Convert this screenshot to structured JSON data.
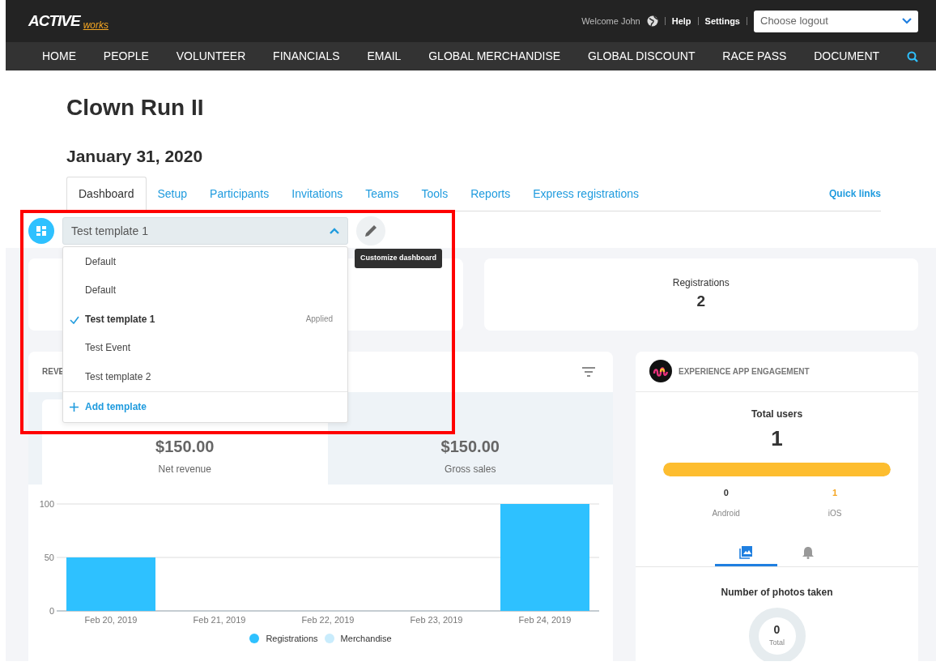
{
  "header": {
    "logo_main": "ACTIVE",
    "logo_sub": "works",
    "welcome": "Welcome John",
    "links": [
      "Help",
      "Settings"
    ],
    "logout_select": {
      "placeholder": "Choose logout"
    }
  },
  "nav": [
    "HOME",
    "PEOPLE",
    "VOLUNTEER",
    "FINANCIALS",
    "EMAIL",
    "GLOBAL MERCHANDISE",
    "GLOBAL DISCOUNT",
    "RACE PASS",
    "DOCUMENT"
  ],
  "event": {
    "title": "Clown Run II",
    "date": "January 31, 2020"
  },
  "tabs": [
    {
      "label": "Dashboard",
      "selected": true
    },
    {
      "label": "Setup",
      "selected": false
    },
    {
      "label": "Participants",
      "selected": false
    },
    {
      "label": "Invitations",
      "selected": false
    },
    {
      "label": "Teams",
      "selected": false
    },
    {
      "label": "Tools",
      "selected": false
    },
    {
      "label": "Reports",
      "selected": false
    },
    {
      "label": "Express registrations",
      "selected": false
    }
  ],
  "quick_links": "Quick links",
  "template_selector": {
    "value": "Test template 1",
    "expanded": true,
    "tooltip": "Customize dashboard",
    "options": [
      {
        "label": "Default",
        "selected": false
      },
      {
        "label": "Default",
        "selected": false
      },
      {
        "label": "Test template 1",
        "selected": true,
        "badge": "Applied"
      },
      {
        "label": "Test Event",
        "selected": false
      },
      {
        "label": "Test template 2",
        "selected": false
      }
    ],
    "add": "Add template"
  },
  "stat_cards": [
    {
      "label": "Registrations",
      "value": "2"
    }
  ],
  "revenue": {
    "title": "REVE",
    "metrics": [
      {
        "value": "$150.00",
        "label": "Net revenue"
      },
      {
        "value": "$150.00",
        "label": "Gross sales"
      }
    ],
    "chart_data": {
      "type": "bar",
      "categories": [
        "Feb 20, 2019",
        "Feb 21, 2019",
        "Feb 22, 2019",
        "Feb 23, 2019",
        "Feb 24, 2019"
      ],
      "series": [
        {
          "name": "Registrations",
          "color": "#2ec1ff",
          "values": [
            50,
            0,
            0,
            0,
            100
          ]
        },
        {
          "name": "Merchandise",
          "color": "#c9ecfc",
          "values": [
            0,
            0,
            0,
            0,
            0
          ]
        }
      ],
      "ylim": [
        0,
        100
      ],
      "yticks": [
        0,
        50,
        100
      ]
    }
  },
  "engagement": {
    "title": "EXPERIENCE APP ENGAGEMENT",
    "total_label": "Total users",
    "total": "1",
    "level": 1,
    "platforms": [
      {
        "count": "0",
        "label": "Android",
        "color": "#333333"
      },
      {
        "count": "1",
        "label": "iOS",
        "color": "#f5a623"
      }
    ],
    "tabs": [
      {
        "kind": "photos",
        "selected": true
      },
      {
        "kind": "notifications",
        "selected": false
      }
    ],
    "photos_title": "Number of photos taken",
    "donut_value": "0",
    "donut_label": "Total"
  },
  "highlight_frame": true
}
